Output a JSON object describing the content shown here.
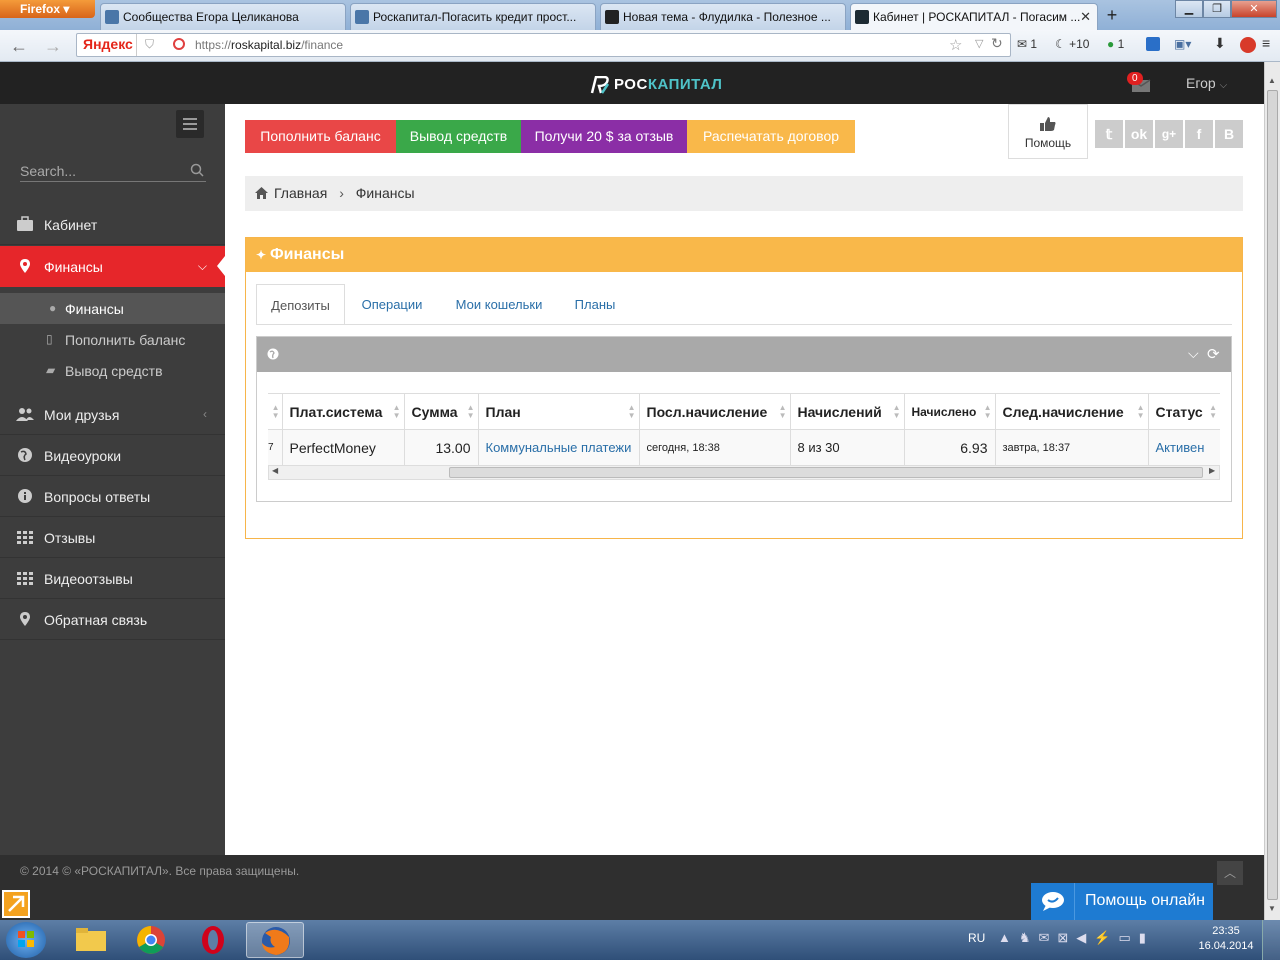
{
  "browser": {
    "menu_button": "Firefox",
    "tabs": [
      {
        "title": "Сообщества Егора Целиканова"
      },
      {
        "title": "Роскапитал-Погасить кредит прост..."
      },
      {
        "title": "Новая тема - Флудилка - Полезное ..."
      },
      {
        "title": "Кабинет | РОСКАПИТАЛ - Погасим ..."
      }
    ],
    "search_engine": "Яндекс",
    "url_scheme": "https://",
    "url_host": "roskapital.biz",
    "url_path": "/finance",
    "toolbar": {
      "mail_count": "1",
      "weather": "+10",
      "badge_count": "1"
    }
  },
  "site": {
    "logo_part1": "РОС",
    "logo_part2": "КАПИТАЛ",
    "notifications": "0",
    "user": "Егор"
  },
  "sidebar": {
    "search_placeholder": "Search...",
    "items": [
      {
        "label": "Кабинет"
      },
      {
        "label": "Финансы"
      },
      {
        "label": "Мои друзья"
      },
      {
        "label": "Видеоуроки"
      },
      {
        "label": "Вопросы ответы"
      },
      {
        "label": "Отзывы"
      },
      {
        "label": "Видеоотзывы"
      },
      {
        "label": "Обратная связь"
      }
    ],
    "subitems": [
      {
        "label": "Финансы"
      },
      {
        "label": "Пополнить баланс"
      },
      {
        "label": "Вывод средств"
      }
    ]
  },
  "actions": {
    "topup": "Пополнить баланс",
    "withdraw": "Вывод средств",
    "review_bonus": "Получи 20 $ за отзыв",
    "print_contract": "Распечатать договор",
    "help": "Помощь",
    "colors": {
      "topup": "#e94747",
      "withdraw": "#3aa849",
      "review_bonus": "#8b2ea6",
      "print_contract": "#f9b84a"
    }
  },
  "breadcrumb": {
    "home": "Главная",
    "current": "Финансы"
  },
  "panel": {
    "title": "Финансы",
    "tabs": [
      "Депозиты",
      "Операции",
      "Мои кошельки",
      "Планы"
    ],
    "table": {
      "columns": [
        "Плат.система",
        "Сумма",
        "План",
        "Посл.начисление",
        "Начислений",
        "Начислено",
        "След.начисление",
        "Статус"
      ],
      "rows": [
        {
          "partial": "7",
          "system": "PerfectMoney",
          "amount": "13.00",
          "plan": "Коммунальные платежи",
          "last": "сегодня, 18:38",
          "count": "8 из 30",
          "accrued": "6.93",
          "next": "завтра, 18:37",
          "status": "Активен"
        }
      ]
    }
  },
  "footer": {
    "copyright": "© 2014 © «РОСКАПИТАЛ». Все права защищены.",
    "help_online": "Помощь онлайн"
  },
  "taskbar": {
    "lang": "RU",
    "time": "23:35",
    "date": "16.04.2014"
  }
}
